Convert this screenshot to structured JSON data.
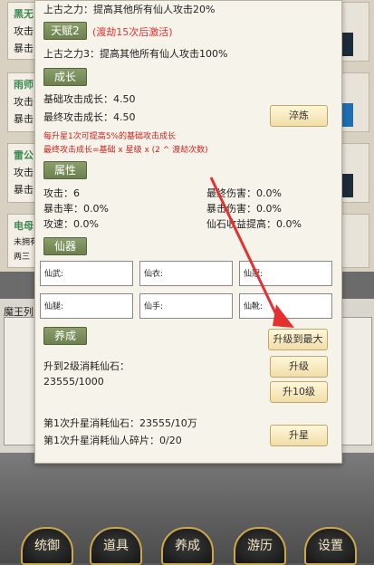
{
  "background": {
    "cards": [
      {
        "title": "黑无",
        "rows": [
          "攻击",
          "暴击"
        ]
      },
      {
        "title": "雨师",
        "rows": [
          "攻击",
          "暴击"
        ]
      },
      {
        "title": "雷公",
        "rows": [
          "攻击",
          "暴击"
        ]
      },
      {
        "title": "电母",
        "rows": [
          "未拥有",
          "两三"
        ]
      }
    ],
    "list_title": "魔王列",
    "nav": [
      "统御",
      "道具",
      "养成",
      "游历",
      "设置"
    ]
  },
  "panel": {
    "talent_line_top": "上古之力：提高其他所有仙人攻击20%",
    "talent2": {
      "tag": "天赋2",
      "condition": "(渡劫15次后激活)",
      "desc": "上古之力3：提高其他所有仙人攻击100%"
    },
    "growth": {
      "tag": "成长",
      "base_growth": "基础攻击成长：4.50",
      "final_growth": "最终攻击成长：4.50",
      "temper_button": "淬炼",
      "note1": "每升星1次可提高5%的基础攻击成长",
      "note2": "最终攻击成长=基础 x 星级 x (2 ^ 渡劫次数)"
    },
    "attributes": {
      "tag": "属性",
      "attack": "攻击：6",
      "final_damage": "最终伤害：0.0%",
      "crit_rate": "暴击率：0.0%",
      "crit_damage": "暴击伤害：0.0%",
      "attack_speed": "攻速：0.0%",
      "income_boost": "仙石收益提高：0.0%"
    },
    "gear": {
      "tag": "仙器",
      "slots": [
        "仙武:",
        "仙衣:",
        "仙冠:",
        "仙腿:",
        "仙手:",
        "仙靴:"
      ]
    },
    "cultivate": {
      "tag": "养成",
      "upgrade_max_button": "升级到最大",
      "upgrade_to": "升到2级消耗仙石：",
      "stones": "23555/1000",
      "upgrade_button": "升级",
      "upgrade10_button": "升10级",
      "star_cost_stones": "第1次升星消耗仙石：23555/10万",
      "star_cost_shards": "第1次升星消耗仙人碎片：0/20",
      "star_button": "升星"
    }
  },
  "colors": {
    "accent_red": "#e53030",
    "tag_green": "#7a8f5c",
    "button_gold": "#f1dea8"
  }
}
